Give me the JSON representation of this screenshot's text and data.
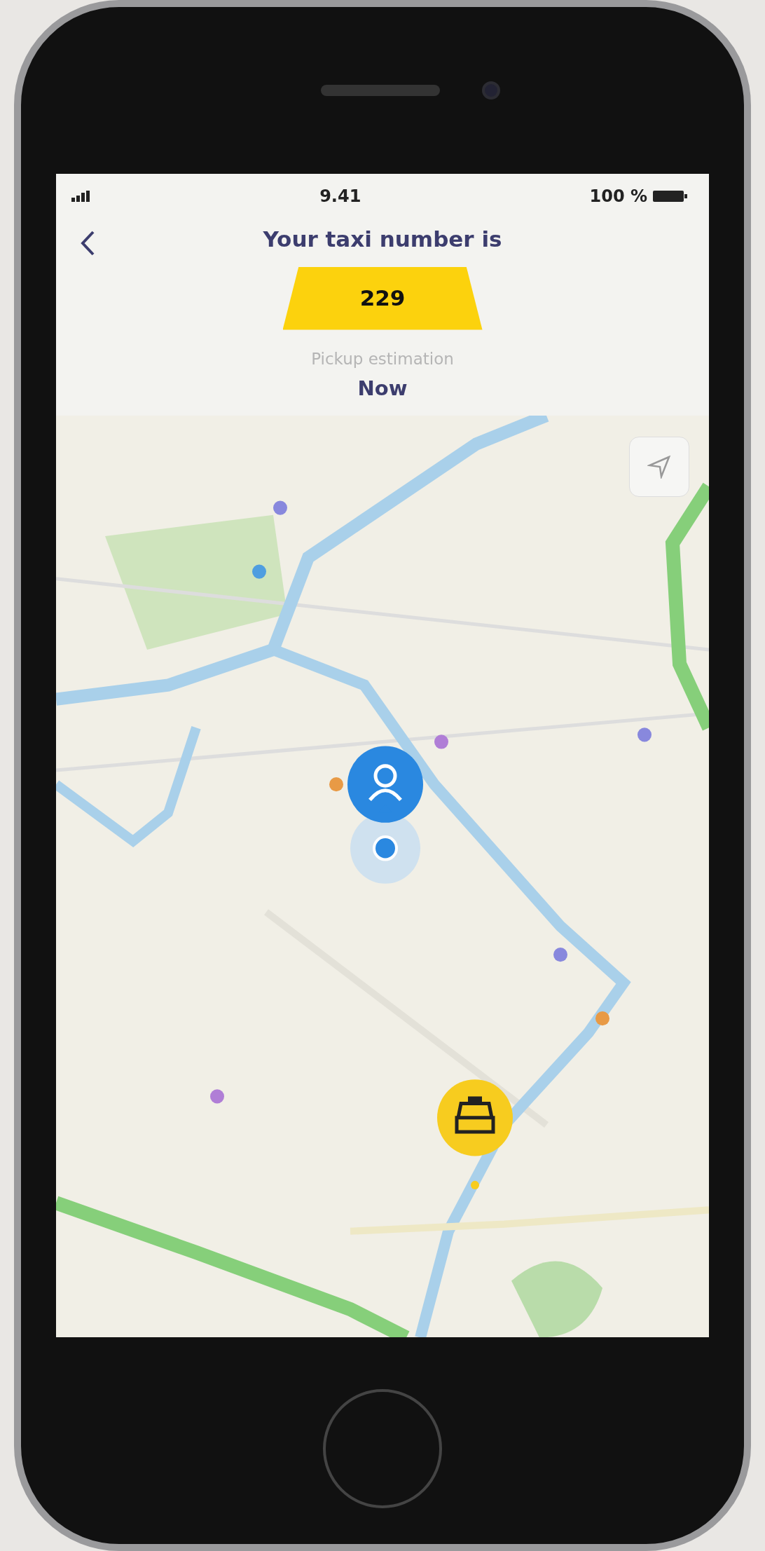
{
  "status_bar": {
    "time": "9.41",
    "battery": "100 %"
  },
  "header": {
    "title": "Your taxi number is",
    "taxi_number": "229"
  },
  "pickup": {
    "label": "Pickup estimation",
    "value": "Now"
  }
}
